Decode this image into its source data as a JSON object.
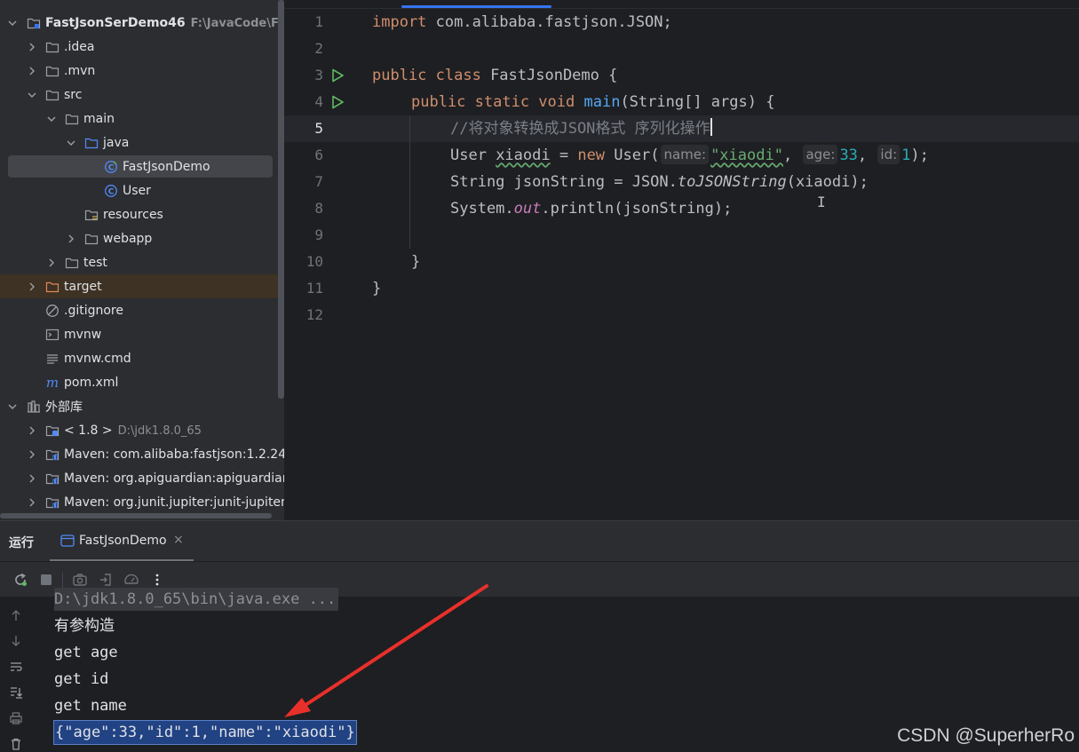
{
  "project_tree": {
    "root": {
      "label": "FastJsonSerDemo46",
      "path": "F:\\JavaCode\\FastJs"
    },
    "items": [
      {
        "label": ".idea"
      },
      {
        "label": ".mvn"
      },
      {
        "label": "src"
      },
      {
        "label": "main"
      },
      {
        "label": "java"
      },
      {
        "label": "FastJsonDemo"
      },
      {
        "label": "User"
      },
      {
        "label": "resources"
      },
      {
        "label": "webapp"
      },
      {
        "label": "test"
      },
      {
        "label": "target"
      },
      {
        "label": ".gitignore"
      },
      {
        "label": "mvnw"
      },
      {
        "label": "mvnw.cmd"
      },
      {
        "label": "pom.xml"
      }
    ],
    "external_libs": {
      "label": "外部库"
    },
    "libs": [
      {
        "label": "< 1.8 >",
        "path": "D:\\jdk1.8.0_65"
      },
      {
        "label": "Maven: com.alibaba:fastjson:1.2.24"
      },
      {
        "label": "Maven: org.apiguardian:apiguardian-a"
      },
      {
        "label": "Maven: org.junit.jupiter:junit-jupiter-ap"
      }
    ]
  },
  "editor": {
    "line_numbers": [
      "1",
      "2",
      "3",
      "4",
      "5",
      "6",
      "7",
      "8",
      "9",
      "10",
      "11",
      "12"
    ],
    "current_line": 5,
    "code": {
      "l1_kw": "import",
      "l1_rest": " com.alibaba.fastjson.JSON;",
      "l3_kw": "public class",
      "l3_rest": " FastJsonDemo {",
      "l4_kw": "public static void",
      "l4_fn": "main",
      "l4_rest": "(String[] args) {",
      "l5_comment": "//将对象转换成JSON格式 序列化操作",
      "l6_a": "User ",
      "l6_var": "xiaodi",
      "l6_b": " = ",
      "l6_new": "new",
      "l6_c": " User(",
      "l6_hint_name": "name:",
      "l6_str": "\"xiaodi\"",
      "l6_d": ", ",
      "l6_hint_age": "age:",
      "l6_age": "33",
      "l6_e": ", ",
      "l6_hint_id": "id:",
      "l6_id": "1",
      "l6_f": ");",
      "l7_a": "String jsonString = JSON.",
      "l7_fn": "toJSONString",
      "l7_b": "(xiaodi);",
      "l8_a": "System.",
      "l8_field": "out",
      "l8_b": ".println(jsonString);",
      "l10": "}",
      "l11": "}"
    }
  },
  "run_panel": {
    "title": "运行",
    "tab_label": "FastJsonDemo",
    "tab_close": "×",
    "console_lines": [
      "D:\\jdk1.8.0_65\\bin\\java.exe ...",
      "有参构造",
      "get age",
      "get id",
      "get name",
      "{\"age\":33,\"id\":1,\"name\":\"xiaodi\"}"
    ]
  },
  "watermark": "CSDN @SuperherRo",
  "colors": {
    "keyword": "#cf8e6d",
    "function": "#56a8f5",
    "string": "#6aab73",
    "number": "#2aacb8",
    "selection": "#214283",
    "annotation_arrow": "#e8302a"
  }
}
